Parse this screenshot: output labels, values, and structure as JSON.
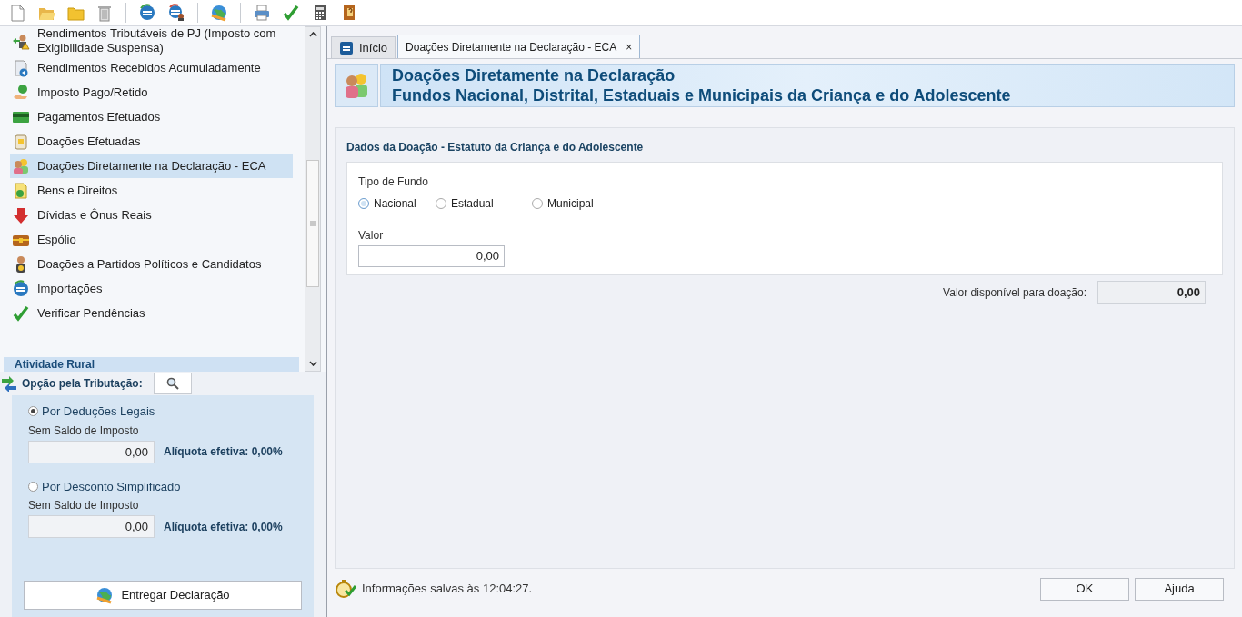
{
  "sidebar": {
    "items": [
      {
        "label": "Rendimentos Tributáveis de PJ (Imposto com Exigibilidade Suspensa)",
        "selected": false
      },
      {
        "label": "Rendimentos Recebidos Acumuladamente",
        "selected": false
      },
      {
        "label": "Imposto Pago/Retido",
        "selected": false
      },
      {
        "label": "Pagamentos Efetuados",
        "selected": false
      },
      {
        "label": "Doações Efetuadas",
        "selected": false
      },
      {
        "label": "Doações Diretamente na Declaração - ECA",
        "selected": true
      },
      {
        "label": "Bens e Direitos",
        "selected": false
      },
      {
        "label": "Dívidas e Ônus Reais",
        "selected": false
      },
      {
        "label": "Espólio",
        "selected": false
      },
      {
        "label": "Doações a Partidos Políticos e Candidatos",
        "selected": false
      },
      {
        "label": "Importações",
        "selected": false
      },
      {
        "label": "Verificar Pendências",
        "selected": false
      }
    ],
    "section": "Atividade Rural"
  },
  "taxation": {
    "title": "Opção pela Tributação:",
    "options": [
      {
        "label": "Por Deduções Legais",
        "selected": true,
        "sublabel": "Sem Saldo de Imposto",
        "value": "0,00",
        "rate": "Alíquota efetiva: 0,00%"
      },
      {
        "label": "Por Desconto Simplificado",
        "selected": false,
        "sublabel": "Sem Saldo de Imposto",
        "value": "0,00",
        "rate": "Alíquota efetiva: 0,00%"
      }
    ],
    "submit": "Entregar Declaração"
  },
  "tabs": [
    {
      "label": "Início",
      "selected": false
    },
    {
      "label": "Doações Diretamente na Declaração - ECA",
      "selected": true,
      "close": "×"
    }
  ],
  "header": {
    "line1": "Doações Diretamente na Declaração",
    "line2": "Fundos Nacional, Distrital, Estaduais e Municipais da Criança e do Adolescente"
  },
  "form": {
    "section": "Dados da Doação - Estatuto da Criança e do Adolescente",
    "fund_label": "Tipo de Fundo",
    "funds": [
      {
        "label": "Nacional",
        "selected": true
      },
      {
        "label": "Estadual",
        "selected": false
      },
      {
        "label": "Municipal",
        "selected": false
      }
    ],
    "value_label": "Valor",
    "value": "0,00",
    "available_label": "Valor disponível para doação:",
    "available": "0,00"
  },
  "status": "Informações salvas às 12:04:27.",
  "buttons": [
    "OK",
    "Ajuda"
  ]
}
